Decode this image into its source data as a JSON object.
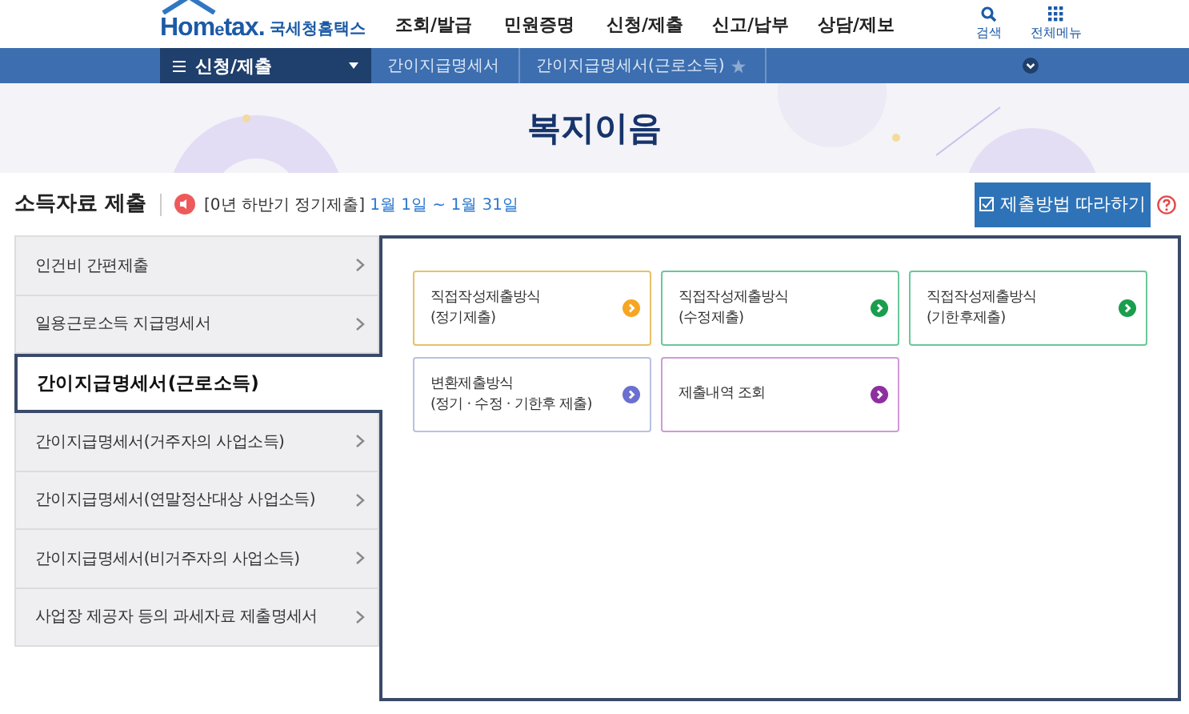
{
  "header": {
    "logo": {
      "brand_prefix": "Hom",
      "brand_e": "e",
      "brand_suffix": "tax.",
      "name": "국세청홈택스"
    },
    "menu": [
      "조회/발급",
      "민원증명",
      "신청/제출",
      "신고/납부",
      "상담/제보"
    ],
    "tools": [
      {
        "kind": "search",
        "label": "검색"
      },
      {
        "kind": "menu",
        "label": "전체메뉴"
      }
    ]
  },
  "nav": {
    "section": "신청/제출",
    "breadcrumbs": [
      {
        "label": "간이지급명세서",
        "favorite": false
      },
      {
        "label": "간이지급명세서(근로소득)",
        "favorite": true
      }
    ]
  },
  "banner": {
    "title": "복지이음"
  },
  "page": {
    "title": "소득자료 제출",
    "notice_label": "[0년 하반기 정기제출]",
    "notice_period": "1월 1일 ~ 1월 31일",
    "guide_button": "제출방법 따라하기"
  },
  "sidebar": {
    "items": [
      {
        "label": "인건비 간편제출",
        "selected": false
      },
      {
        "label": "일용근로소득 지급명세서",
        "selected": false
      },
      {
        "label": "간이지급명세서(근로소득)",
        "selected": true
      },
      {
        "label": "간이지급명세서(거주자의 사업소득)",
        "selected": false
      },
      {
        "label": "간이지급명세서(연말정산대상 사업소득)",
        "selected": false
      },
      {
        "label": "간이지급명세서(비거주자의 사업소득)",
        "selected": false
      },
      {
        "label": "사업장 제공자 등의 과세자료 제출명세서",
        "selected": false
      }
    ]
  },
  "cards": [
    {
      "lines": [
        "직접작성제출방식",
        "(정기제출)"
      ],
      "color": "#f6a623"
    },
    {
      "lines": [
        "직접작성제출방식",
        "(수정제출)"
      ],
      "color": "#1a9e4e"
    },
    {
      "lines": [
        "직접작성제출방식",
        "(기한후제출)"
      ],
      "color": "#1a9e4e"
    },
    {
      "lines": [
        "변환제출방식",
        "(정기 · 수정 · 기한후 제출)"
      ],
      "color": "#6a6fd0"
    },
    {
      "lines": [
        "제출내역 조회"
      ],
      "color": "#8e2fa0"
    }
  ]
}
